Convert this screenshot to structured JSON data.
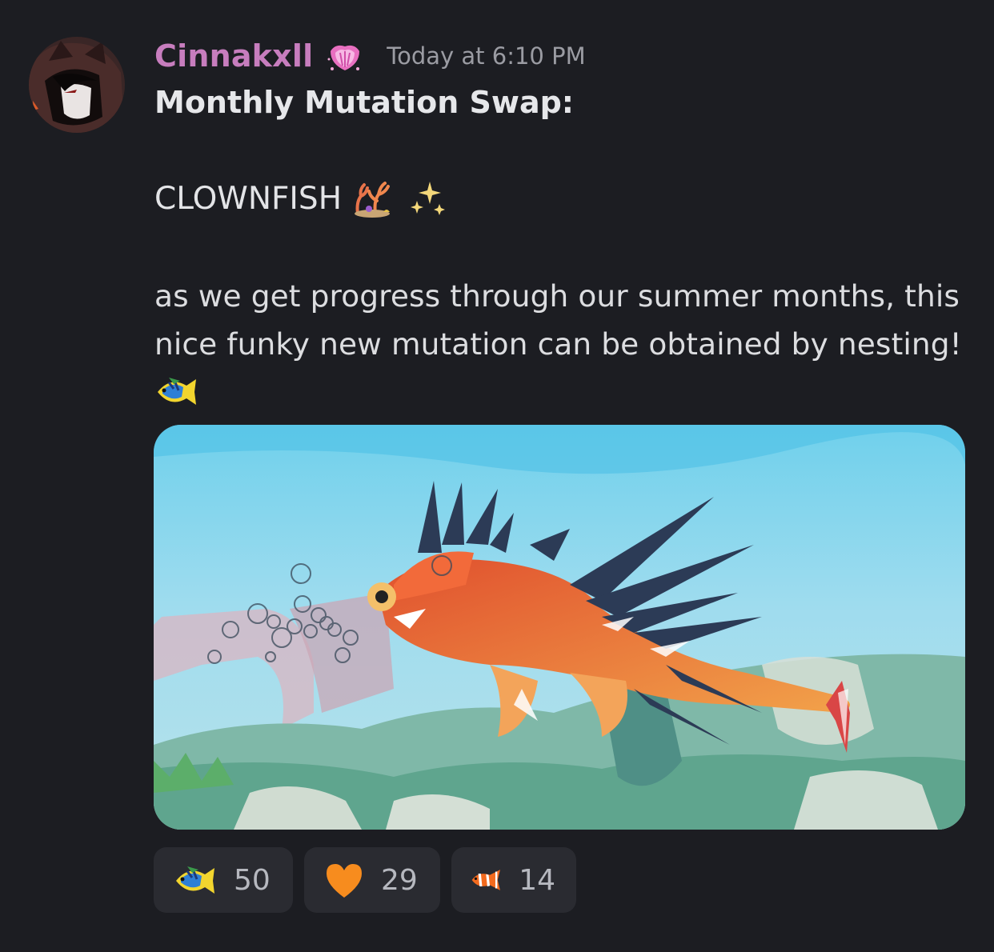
{
  "message": {
    "author": "Cinnakxll",
    "timestamp": "Today at 6:10 PM",
    "title": "Monthly Mutation Swap:",
    "mutation": "CLOWNFISH",
    "body": "as we get progress through our summer months, this nice funky new mutation can be obtained by nesting!",
    "author_color": "#c77dbe"
  },
  "reactions": [
    {
      "emoji": "tropical-fish",
      "count": "50"
    },
    {
      "emoji": "orange-heart",
      "count": "29"
    },
    {
      "emoji": "clownfish",
      "count": "14"
    }
  ]
}
